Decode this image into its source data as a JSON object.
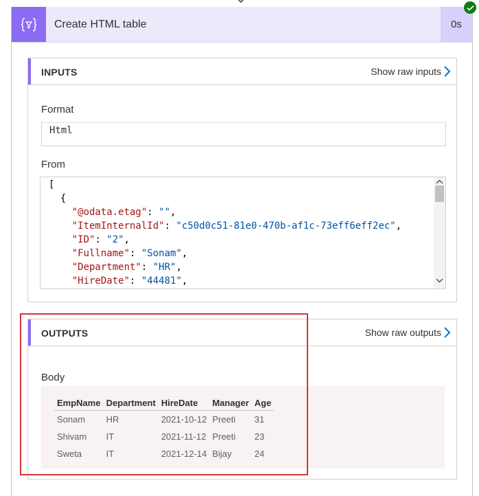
{
  "action": {
    "title": "Create HTML table",
    "duration": "0s",
    "icon": "data-operation-icon",
    "status_icon": "success-check-icon"
  },
  "inputs": {
    "title": "INPUTS",
    "show_raw_label": "Show raw inputs",
    "format_label": "Format",
    "format_value": "Html",
    "from_label": "From",
    "from_lines": [
      "[",
      "  {",
      "    \"@odata.etag\": \"\",",
      "    \"ItemInternalId\": \"c50d0c51-81e0-470b-af1c-73eff6eff2ec\",",
      "    \"ID\": \"2\",",
      "    \"Fullname\": \"Sonam\",",
      "    \"Department\": \"HR\",",
      "    \"HireDate\": \"44481\","
    ]
  },
  "outputs": {
    "title": "OUTPUTS",
    "show_raw_label": "Show raw outputs",
    "body_label": "Body",
    "table": {
      "headers": [
        "EmpName",
        "Department",
        "HireDate",
        "Manager",
        "Age"
      ],
      "rows": [
        [
          "Sonam",
          "HR",
          "2021-10-12",
          "Preeti",
          "31"
        ],
        [
          "Shivam",
          "IT",
          "2021-11-12",
          "Preeti",
          "23"
        ],
        [
          "Sweta",
          "IT",
          "2021-12-14",
          "Bijay",
          "24"
        ]
      ]
    }
  },
  "colors": {
    "accent": "#8c6cf2",
    "header_bg": "#ede9fb",
    "success": "#107c10",
    "highlight": "#d13438",
    "link": "#0078d4"
  }
}
